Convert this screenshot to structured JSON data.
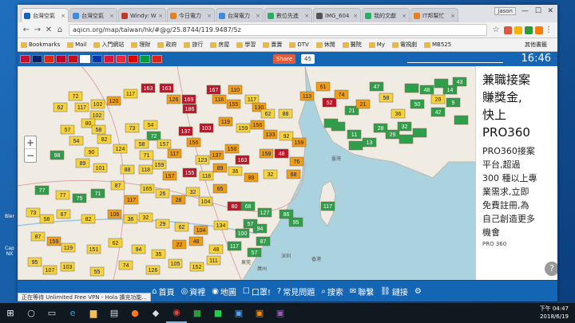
{
  "browser": {
    "tabs": [
      {
        "label": "台灣空氣",
        "color": "#1565b5",
        "active": true
      },
      {
        "label": "台灣空氣",
        "color": "#3c8be0"
      },
      {
        "label": "Windy: W",
        "color": "#c0392b"
      },
      {
        "label": "今日電力",
        "color": "#e67e22"
      },
      {
        "label": "台灣電力",
        "color": "#3c8be0"
      },
      {
        "label": "數位先進",
        "color": "#27ae60"
      },
      {
        "label": "IMG_604",
        "color": "#555"
      },
      {
        "label": "我的文獻",
        "color": "#27ae60"
      },
      {
        "label": "IT邦幫忙",
        "color": "#e67e22"
      }
    ],
    "profile": "jason",
    "url": "aqicn.org/map/taiwan/hk/#@g/25.8744/119.9487/5z",
    "bookmarks": [
      "Bookmarks",
      "Mail",
      "入門網站",
      "理財",
      "政府",
      "旅行",
      "房屋",
      "學習",
      "賣賣",
      "DTV",
      "休閒",
      "醫院",
      "My",
      "電視劇",
      "MB525"
    ],
    "other_bookmarks": "其他書籤"
  },
  "site": {
    "share_label": "Share",
    "share_count": "45",
    "clock": "16:46",
    "flag_colors": [
      "#c8102e",
      "#012169",
      "#de2910",
      "#bc002d",
      "#c60b1e",
      "#ffffff",
      "#0039a6",
      "#dc143c",
      "#ed2939",
      "#dd0000",
      "#009c3b",
      "#da251d"
    ]
  },
  "map": {
    "city_labels": [
      "東莞",
      "廣州",
      "深圳",
      "香港",
      "臺灣"
    ],
    "aqi_markers": [
      [
        72,
        38,
        "yellow"
      ],
      [
        53,
        52,
        "yellow"
      ],
      [
        80,
        52,
        "yellow"
      ],
      [
        99,
        62,
        "yellow"
      ],
      [
        100,
        48,
        "yellow"
      ],
      [
        120,
        44,
        "orange"
      ],
      [
        141,
        35,
        "yellow"
      ],
      [
        163,
        28,
        "red"
      ],
      [
        186,
        28,
        "red"
      ],
      [
        195,
        42,
        "orange"
      ],
      [
        214,
        42,
        "red"
      ],
      [
        215,
        54,
        "red"
      ],
      [
        245,
        30,
        "red"
      ],
      [
        252,
        42,
        "orange"
      ],
      [
        272,
        30,
        "orange"
      ],
      [
        270,
        48,
        "orange"
      ],
      [
        293,
        42,
        "yellow"
      ],
      [
        302,
        52,
        "orange"
      ],
      [
        313,
        60,
        "yellow"
      ],
      [
        335,
        60,
        "yellow"
      ],
      [
        88,
        72,
        "yellow"
      ],
      [
        62,
        80,
        "yellow"
      ],
      [
        101,
        80,
        "yellow"
      ],
      [
        108,
        92,
        "yellow"
      ],
      [
        143,
        78,
        "yellow"
      ],
      [
        166,
        74,
        "yellow"
      ],
      [
        170,
        88,
        "green"
      ],
      [
        155,
        98,
        "yellow"
      ],
      [
        183,
        98,
        "yellow"
      ],
      [
        210,
        82,
        "red"
      ],
      [
        220,
        96,
        "orange"
      ],
      [
        236,
        78,
        "red"
      ],
      [
        260,
        70,
        "orange"
      ],
      [
        282,
        78,
        "yellow"
      ],
      [
        300,
        74,
        "orange"
      ],
      [
        316,
        86,
        "orange"
      ],
      [
        336,
        88,
        "yellow"
      ],
      [
        352,
        96,
        "orange"
      ],
      [
        73,
        94,
        "yellow"
      ],
      [
        92,
        108,
        "yellow"
      ],
      [
        128,
        104,
        "yellow"
      ],
      [
        161,
        112,
        "yellow"
      ],
      [
        196,
        110,
        "orange"
      ],
      [
        231,
        118,
        "yellow"
      ],
      [
        249,
        112,
        "orange"
      ],
      [
        268,
        104,
        "orange"
      ],
      [
        281,
        118,
        "red"
      ],
      [
        311,
        110,
        "orange"
      ],
      [
        330,
        110,
        "red"
      ],
      [
        349,
        120,
        "orange"
      ],
      [
        49,
        112,
        "green"
      ],
      [
        81,
        122,
        "yellow"
      ],
      [
        103,
        128,
        "yellow"
      ],
      [
        137,
        130,
        "yellow"
      ],
      [
        160,
        130,
        "yellow"
      ],
      [
        177,
        124,
        "yellow"
      ],
      [
        190,
        138,
        "orange"
      ],
      [
        215,
        134,
        "red"
      ],
      [
        236,
        138,
        "yellow"
      ],
      [
        253,
        128,
        "orange"
      ],
      [
        272,
        132,
        "yellow"
      ],
      [
        292,
        140,
        "orange"
      ],
      [
        316,
        136,
        "yellow"
      ],
      [
        345,
        136,
        "orange"
      ],
      [
        30,
        156,
        "green"
      ],
      [
        56,
        162,
        "yellow"
      ],
      [
        77,
        166,
        "green"
      ],
      [
        100,
        160,
        "green"
      ],
      [
        125,
        150,
        "yellow"
      ],
      [
        142,
        168,
        "orange"
      ],
      [
        162,
        154,
        "yellow"
      ],
      [
        181,
        160,
        "yellow"
      ],
      [
        201,
        168,
        "orange"
      ],
      [
        219,
        158,
        "yellow"
      ],
      [
        235,
        170,
        "yellow"
      ],
      [
        253,
        154,
        "orange"
      ],
      [
        271,
        176,
        "red"
      ],
      [
        288,
        176,
        "green"
      ],
      [
        309,
        184,
        "green"
      ],
      [
        336,
        186,
        "green"
      ],
      [
        19,
        184,
        "yellow"
      ],
      [
        36,
        192,
        "yellow"
      ],
      [
        57,
        186,
        "yellow"
      ],
      [
        88,
        192,
        "yellow"
      ],
      [
        121,
        186,
        "orange"
      ],
      [
        141,
        192,
        "yellow"
      ],
      [
        160,
        190,
        "yellow"
      ],
      [
        181,
        198,
        "yellow"
      ],
      [
        205,
        202,
        "yellow"
      ],
      [
        229,
        206,
        "orange"
      ],
      [
        254,
        200,
        "yellow"
      ],
      [
        281,
        210,
        "green"
      ],
      [
        291,
        198,
        "green"
      ],
      [
        303,
        204,
        "green"
      ],
      [
        25,
        214,
        "yellow"
      ],
      [
        45,
        220,
        "orange"
      ],
      [
        63,
        228,
        "yellow"
      ],
      [
        95,
        230,
        "yellow"
      ],
      [
        122,
        222,
        "yellow"
      ],
      [
        151,
        230,
        "yellow"
      ],
      [
        176,
        236,
        "yellow"
      ],
      [
        202,
        224,
        "orange"
      ],
      [
        223,
        220,
        "orange"
      ],
      [
        248,
        230,
        "yellow"
      ],
      [
        271,
        226,
        "green"
      ],
      [
        296,
        234,
        "green"
      ],
      [
        307,
        220,
        "green"
      ],
      [
        348,
        196,
        "green"
      ],
      [
        388,
        176,
        "green"
      ],
      [
        21,
        246,
        "yellow"
      ],
      [
        40,
        256,
        "yellow"
      ],
      [
        62,
        252,
        "yellow"
      ],
      [
        99,
        258,
        "yellow"
      ],
      [
        135,
        250,
        "yellow"
      ],
      [
        169,
        256,
        "yellow"
      ],
      [
        197,
        248,
        "yellow"
      ],
      [
        224,
        252,
        "yellow"
      ],
      [
        245,
        244,
        "yellow"
      ],
      [
        362,
        38,
        "orange"
      ],
      [
        382,
        26,
        "orange"
      ],
      [
        390,
        46,
        "red"
      ],
      [
        405,
        36,
        "orange"
      ],
      [
        418,
        56,
        "green"
      ],
      [
        432,
        48,
        "orange"
      ],
      [
        449,
        26,
        "green"
      ],
      [
        461,
        40,
        "yellow"
      ],
      [
        476,
        60,
        "yellow"
      ],
      [
        500,
        48,
        "green"
      ],
      [
        512,
        30,
        "green"
      ],
      [
        526,
        42,
        "yellow"
      ],
      [
        541,
        30,
        "green"
      ],
      [
        545,
        46,
        "green"
      ],
      [
        553,
        20,
        "green"
      ],
      [
        526,
        58,
        "green"
      ],
      [
        421,
        86,
        "green"
      ],
      [
        440,
        96,
        "green"
      ],
      [
        454,
        78,
        "green"
      ],
      [
        469,
        86,
        "green"
      ],
      [
        484,
        76,
        "green"
      ],
      [
        486,
        92,
        "green"
      ],
      [
        503,
        84,
        "green"
      ],
      [
        423,
        100,
        "green"
      ],
      [
        401,
        76,
        "green"
      ],
      [
        392,
        72,
        "green"
      ],
      [
        555,
        68,
        "green"
      ],
      [
        493,
        28,
        "green"
      ],
      [
        530,
        22,
        "green"
      ]
    ],
    "aqi_values": [
      "72",
      "62",
      "117",
      "102",
      "102",
      "120",
      "117",
      "163",
      "163",
      "126",
      "169",
      "186",
      "167",
      "118",
      "110",
      "155",
      "117",
      "130",
      "62",
      "88",
      "80",
      "57",
      "58",
      "82",
      "73",
      "54",
      "72",
      "58",
      "157",
      "137",
      "156",
      "103",
      "119",
      "159",
      "156",
      "133",
      "92",
      "159",
      "54",
      "90",
      "124",
      "71",
      "117",
      "123",
      "137",
      "158",
      "163",
      "158",
      "48",
      "76",
      "98",
      "89",
      "101",
      "88",
      "118",
      "159",
      "157",
      "155",
      "118",
      "89",
      "36",
      "89",
      "32",
      "68",
      "77",
      "77",
      "75",
      "71",
      "87",
      "117",
      "165",
      "26",
      "28",
      "32",
      "104",
      "65",
      "80",
      "68",
      "127",
      "86",
      "73",
      "58",
      "67",
      "82",
      "106",
      "36",
      "32",
      "29",
      "62",
      "104",
      "134",
      "100",
      "57",
      "94",
      "87",
      "159",
      "119",
      "151",
      "62",
      "94",
      "35",
      "22",
      "48",
      "48",
      "117",
      "57",
      "87",
      "95",
      "117",
      "95",
      "107",
      "103",
      "55",
      "74",
      "126",
      "105",
      "152",
      "111",
      "113",
      "61",
      "52",
      "74",
      "21",
      "21",
      "47",
      "58",
      "36",
      "50",
      "48",
      "29",
      "14",
      "9",
      "43",
      "42",
      "11",
      "13",
      "28",
      "29",
      "32"
    ],
    "zoom_in": "+",
    "zoom_out": "−"
  },
  "ad": {
    "headline": [
      "兼職接案",
      "賺獎金,",
      "快上",
      "PRO360"
    ],
    "body": [
      "PRO360接案",
      "平台,超過",
      "300 種以上專",
      "業需求,立即",
      "免費註冊,為",
      "自己創造更多",
      "機會"
    ],
    "brand": "PRO 360"
  },
  "footer": [
    {
      "icon": "⌂",
      "label": "首頁"
    },
    {
      "icon": "◎",
      "label": "資裡"
    },
    {
      "icon": "◉",
      "label": "地圖"
    },
    {
      "icon": "☐",
      "label": "口罩!"
    },
    {
      "icon": "?",
      "label": "常見問題"
    },
    {
      "icon": "⌕",
      "label": "搜索"
    },
    {
      "icon": "✉",
      "label": "聯繫"
    },
    {
      "icon": "⛓",
      "label": "鏈接"
    },
    {
      "icon": "⚙",
      "label": ""
    }
  ],
  "status": "正在等待 Unlimited Free VPN - Hola 擴充功能...",
  "taskbar": {
    "time": "下午 04:47",
    "date": "2018/6/19"
  }
}
